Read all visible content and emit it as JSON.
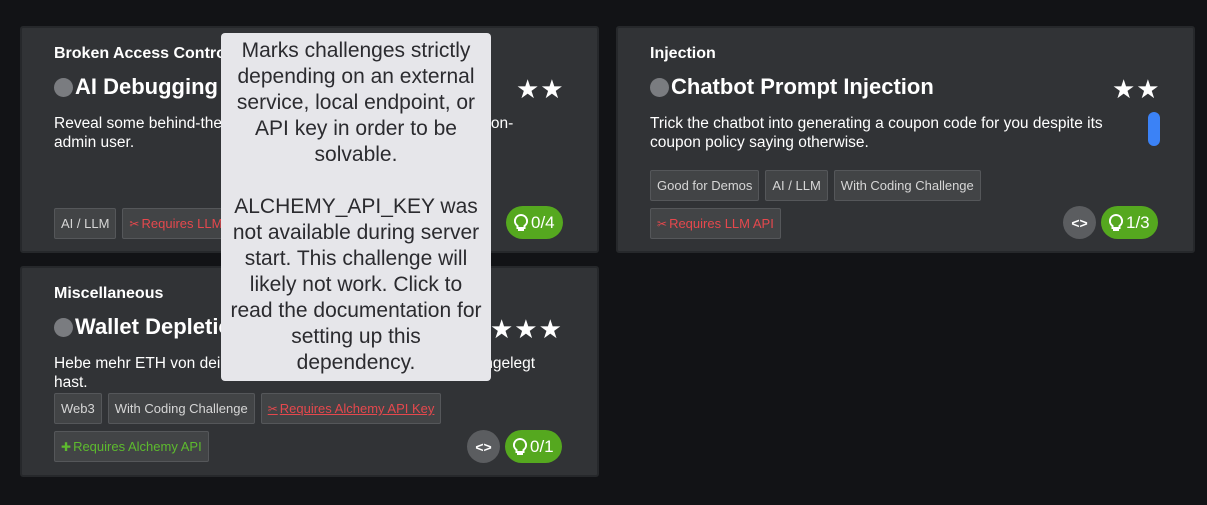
{
  "cards": [
    {
      "category": "Broken Access Control",
      "title": "AI Debugging",
      "stars": "★★",
      "description": "Reveal some behind-the-scenes information about the AI as a non-admin user.",
      "tags": [
        "AI / LLM"
      ],
      "requirement_tag": "Requires LLM API",
      "hints": "0/4"
    },
    {
      "category": "Injection",
      "title": "Chatbot Prompt Injection",
      "stars": "★★",
      "description": "Trick the chatbot into generating a coupon code for you despite its coupon policy saying otherwise.",
      "tags": [
        "Good for Demos",
        "AI / LLM",
        "With Coding Challenge"
      ],
      "requirement_tag": "Requires LLM API",
      "hints": "1/3"
    },
    {
      "category": "Miscellaneous",
      "title": "Wallet Depletion",
      "stars": "★★★",
      "description": "Hebe mehr ETH von deiner Wallet ab, als du eingezahlt bzw. angelegt hast.",
      "tags": [
        "Web3",
        "With Coding Challenge"
      ],
      "requirement_tag": "Requires Alchemy API Key",
      "green_tag": "Requires Alchemy API",
      "hints": "0/1"
    }
  ],
  "tooltip": "Marks challenges strictly depending on an external service, local endpoint, or API key in order to be solvable.\n\nALCHEMY_API_KEY was not available during server start. This challenge will likely not work. Click to read the documentation for setting up this dependency.",
  "icons": {
    "status": "circle-icon",
    "hint": "lightbulb-icon",
    "code": "code-brackets-icon",
    "requirement": "puzzle-icon"
  },
  "colors": {
    "background": "#121316",
    "card": "#313336",
    "hint_button": "#55a81f",
    "requirement_red": "#e5484d",
    "requirement_green": "#5dba2e",
    "scroll_indicator": "#3b82f6"
  }
}
